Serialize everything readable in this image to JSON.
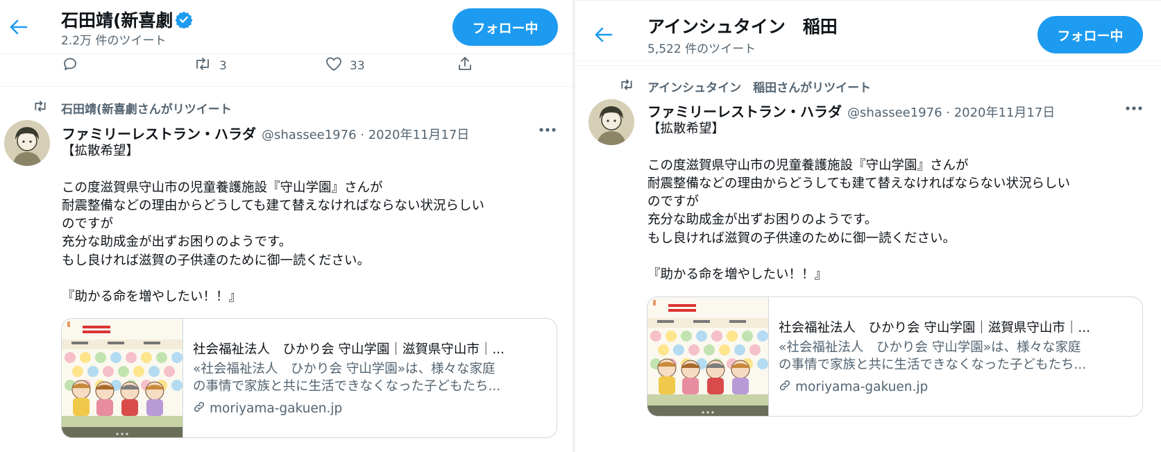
{
  "colors": {
    "accent": "#1d9bf0",
    "text_primary": "#0f1419",
    "text_secondary": "#536471",
    "border": "#cfd9de"
  },
  "left": {
    "header": {
      "name": "石田靖(新喜劇",
      "tweet_count": "2.2万 件のツイート",
      "follow_label": "フォロー中",
      "back_icon": "arrow-left-icon",
      "verified_icon": "verified-badge-icon"
    },
    "actions": {
      "retweet_count": "3",
      "like_count": "33"
    },
    "retweeter": "石田靖(新喜劇さんがリツイート",
    "tweet": {
      "author": "ファミリーレストラン・ハラダ",
      "meta": "@shassee1976 · 2020年11月17日",
      "text": "【拡散希望】\n\nこの度滋賀県守山市の児童養護施設『守山学園』さんが\n耐震整備などの理由からどうしても建て替えなければならない状況らしい\nのですが\n充分な助成金が出ずお困りのようです。\nもし良ければ滋賀の子供達のために御一読ください。\n\n『助かる命を増やしたい！！』"
    },
    "card": {
      "title": "社会福祉法人　ひかり会 守山学園｜滋賀県守山市｜...",
      "desc_line1": "«社会福祉法人　ひかり会 守山学園»は、様々な家庭",
      "desc_line2": "の事情で家族と共に生活できなくなった子どもたち...",
      "domain": "moriyama-gakuen.jp"
    }
  },
  "right": {
    "header": {
      "name": "アインシュタイン　稲田",
      "tweet_count": "5,522 件のツイート",
      "follow_label": "フォロー中",
      "back_icon": "arrow-left-icon"
    },
    "retweeter": "アインシュタイン　稲田さんがリツイート",
    "tweet": {
      "author": "ファミリーレストラン・ハラダ",
      "meta": "@shassee1976 · 2020年11月17日",
      "text": "【拡散希望】\n\nこの度滋賀県守山市の児童養護施設『守山学園』さんが\n耐震整備などの理由からどうしても建て替えなければならない状況らしい\nのですが\n充分な助成金が出ずお困りのようです。\nもし良ければ滋賀の子供達のために御一読ください。\n\n『助かる命を増やしたい！！』"
    },
    "card": {
      "title": "社会福祉法人　ひかり会 守山学園｜滋賀県守山市｜...",
      "desc_line1": "«社会福祉法人　ひかり会 守山学園»は、様々な家庭",
      "desc_line2": "の事情で家族と共に生活できなくなった子どもたち...",
      "domain": "moriyama-gakuen.jp"
    }
  }
}
